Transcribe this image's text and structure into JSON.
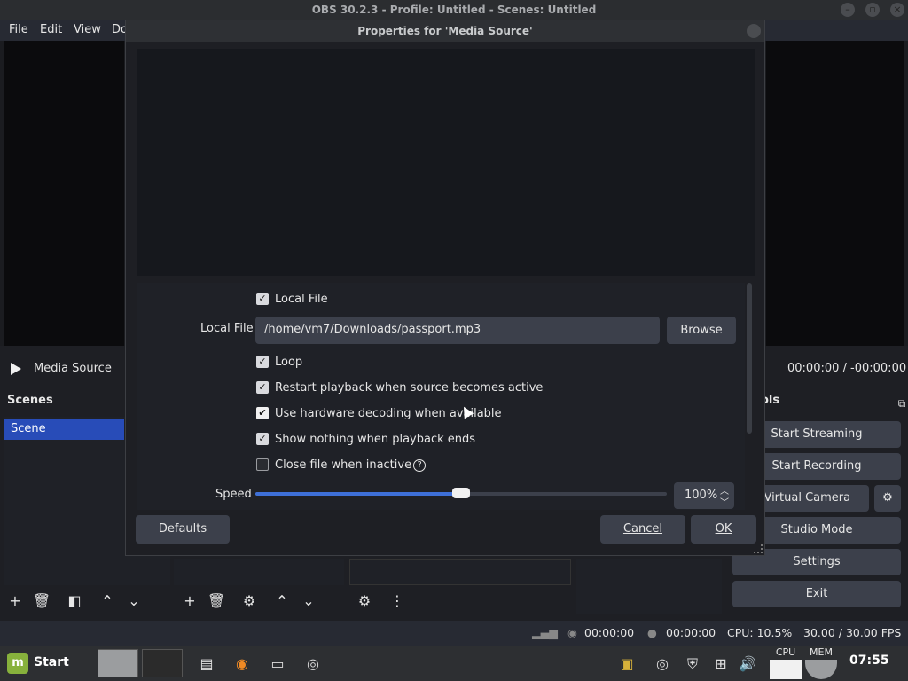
{
  "window": {
    "title": "OBS 30.2.3 - Profile: Untitled - Scenes: Untitled"
  },
  "menu": {
    "file": "File",
    "edit": "Edit",
    "view": "View",
    "docks": "Do"
  },
  "source_bar": {
    "name": "Media Source",
    "time": "00:00:00  /  -00:00:00"
  },
  "scenes": {
    "title": "Scenes",
    "items": [
      "Scene"
    ]
  },
  "controls": {
    "title": "ols",
    "start_streaming": "Start Streaming",
    "start_recording": "Start Recording",
    "virtual_camera": "rt Virtual Camera",
    "studio_mode": "Studio Mode",
    "settings": "Settings",
    "exit": "Exit"
  },
  "status": {
    "stream_time": "00:00:00",
    "rec_time": "00:00:00",
    "cpu": "CPU: 10.5%",
    "fps": "30.00 / 30.00 FPS"
  },
  "taskbar": {
    "start": "Start",
    "clock": "07:55",
    "cpu_label": "CPU",
    "mem_label": "MEM"
  },
  "dialog": {
    "title": "Properties for 'Media Source'",
    "local_file_checkbox": {
      "label": "Local File",
      "checked": true
    },
    "local_file_label": "Local File",
    "local_file_value": "/home/vm7/Downloads/passport.mp3",
    "browse": "Browse",
    "loop": {
      "label": "Loop",
      "checked": true
    },
    "restart": {
      "label": "Restart playback when source becomes active",
      "checked": true
    },
    "hw_decoding": {
      "label": "Use hardware decoding when available",
      "checked": true
    },
    "show_nothing": {
      "label": "Show nothing when playback ends",
      "checked": true
    },
    "close_inactive": {
      "label": "Close file when inactive",
      "checked": false
    },
    "speed_label": "Speed",
    "speed_value": "100%",
    "speed_fraction": 0.5,
    "defaults": "Defaults",
    "cancel": "Cancel",
    "ok": "OK"
  },
  "colors": {
    "accent": "#284cb8",
    "slider": "#3e70d8"
  }
}
